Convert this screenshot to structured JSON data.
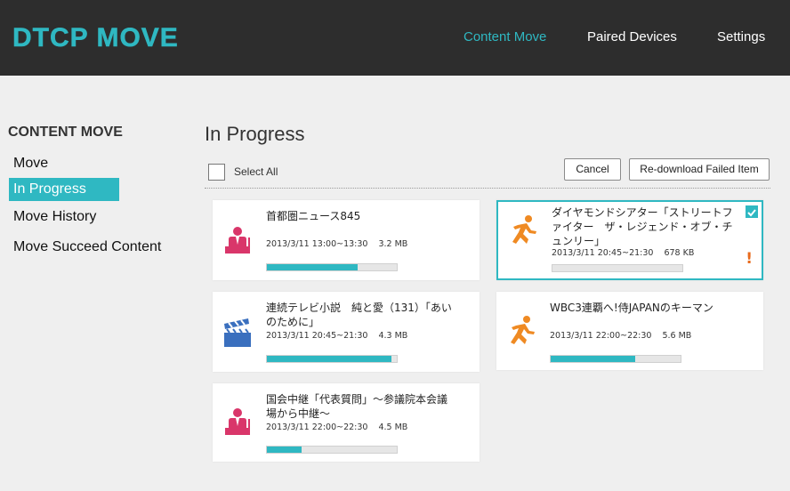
{
  "header": {
    "logo": "DTCP MOVE",
    "nav": [
      "Content Move",
      "Paired Devices",
      "Settings"
    ],
    "accent": "#2fb8c2",
    "background": "#2d2d2d"
  },
  "sidebar": {
    "title": "CONTENT MOVE",
    "items": [
      "Move",
      "In Progress",
      "Move History",
      "Move Succeed Content"
    ],
    "active": "In Progress"
  },
  "main": {
    "title": "In Progress",
    "select_all_label": "Select All",
    "buttons": {
      "cancel": "Cancel",
      "redownload": "Re-download Failed Item"
    }
  },
  "items": [
    {
      "title": "首都圏ニュース845",
      "datetime": "2013/3/11 13:00~13:30",
      "size": "3.2 MB",
      "progress": 0.7,
      "icon": "news-presenter-icon",
      "selected": false,
      "failed": false
    },
    {
      "title": "ダイヤモンドシアター「ストリートファイター　ザ・レジェンド・オブ・チュンリー」",
      "datetime": "2013/3/11 20:45~21:30",
      "size": "678 KB",
      "progress": 0.0,
      "icon": "running-figure-icon",
      "selected": true,
      "failed": true,
      "alert_mark": "!"
    },
    {
      "title": "連続テレビ小説　純と愛（131）「あいのために」",
      "datetime": "2013/3/11 20:45~21:30",
      "size": "4.3 MB",
      "progress": 0.96,
      "icon": "clapperboard-icon",
      "selected": false,
      "failed": false
    },
    {
      "title": "WBC3連覇へ!侍JAPANのキーマン",
      "datetime": "2013/3/11 22:00~22:30",
      "size": "5.6 MB",
      "progress": 0.65,
      "icon": "running-figure-icon",
      "selected": false,
      "failed": false
    },
    {
      "title": "国会中継「代表質問」～参議院本会議場から中継～",
      "datetime": "2013/3/11 22:00~22:30",
      "size": "4.5 MB",
      "progress": 0.27,
      "icon": "news-presenter-icon",
      "selected": false,
      "failed": false
    }
  ]
}
